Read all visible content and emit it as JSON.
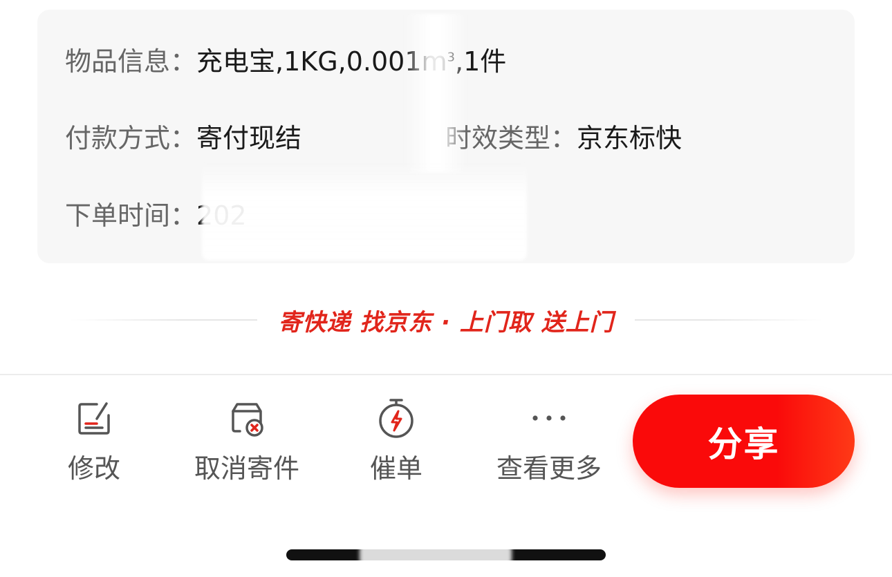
{
  "info": {
    "item_label": "物品信息：",
    "item_value": "充电宝,1KG,0.001m",
    "item_sup": "3",
    "item_count": ",1件",
    "pay_label": "付款方式：",
    "pay_value": "寄付现结",
    "type_label": "时效类型：",
    "type_value": "京东标快",
    "time_label": "下单时间：",
    "time_value": "202"
  },
  "slogan": "寄快递 找京东 · 上门取 送上门",
  "actions": {
    "edit_label": "修改",
    "cancel_label": "取消寄件",
    "urge_label": "催单",
    "more_label": "查看更多",
    "share_label": "分享"
  },
  "icons": {
    "edit": "edit-note-icon",
    "cancel": "cancel-package-icon",
    "urge": "stopwatch-bolt-icon",
    "more": "more-dots-icon"
  },
  "colors": {
    "accent": "#e1251b",
    "share_button": "#fa0a0a",
    "card_bg": "#f7f7f7"
  }
}
